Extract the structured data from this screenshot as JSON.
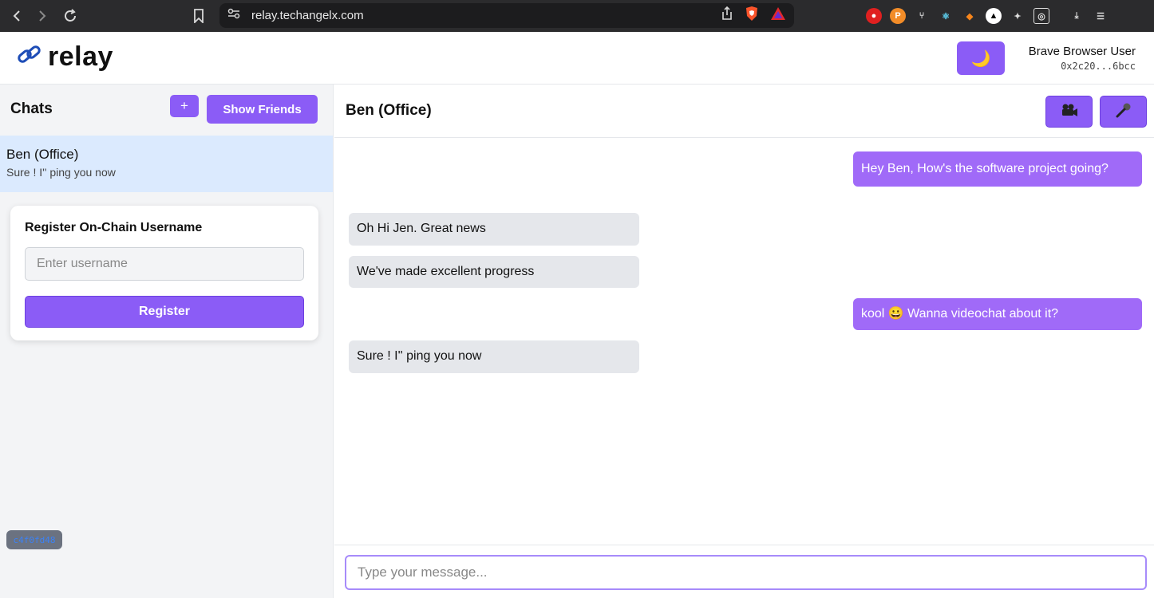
{
  "browser": {
    "url": "relay.techangelx.com"
  },
  "app": {
    "logo_text": "relay",
    "theme_icon": "🌙",
    "user_name": "Brave Browser User",
    "user_address": "0x2c20...6bcc"
  },
  "sidebar": {
    "title": "Chats",
    "add_label": "+",
    "show_friends_label": "Show Friends",
    "chats": [
      {
        "name": "Ben (Office)",
        "preview": "Sure ! I'' ping you now"
      }
    ],
    "register": {
      "title": "Register On-Chain Username",
      "placeholder": "Enter username",
      "button_label": "Register"
    },
    "version_badge": "c4f0fd48"
  },
  "chat": {
    "title": "Ben (Office)",
    "messages": [
      {
        "direction": "out",
        "text": "Hey Ben, How's the software project going?"
      },
      {
        "direction": "in",
        "text": "Oh Hi Jen. Great news"
      },
      {
        "direction": "in",
        "text": "We've made excellent progress"
      },
      {
        "direction": "out",
        "text": "kool 😀 Wanna videochat about it?"
      },
      {
        "direction": "in",
        "text": "Sure ! I'' ping you now"
      }
    ],
    "input_placeholder": "Type your message..."
  },
  "colors": {
    "accent": "#8b5cf6",
    "outgoing_bubble": "#a06af8",
    "incoming_bubble": "#e5e7eb",
    "selected_chat": "#dbeafe"
  }
}
